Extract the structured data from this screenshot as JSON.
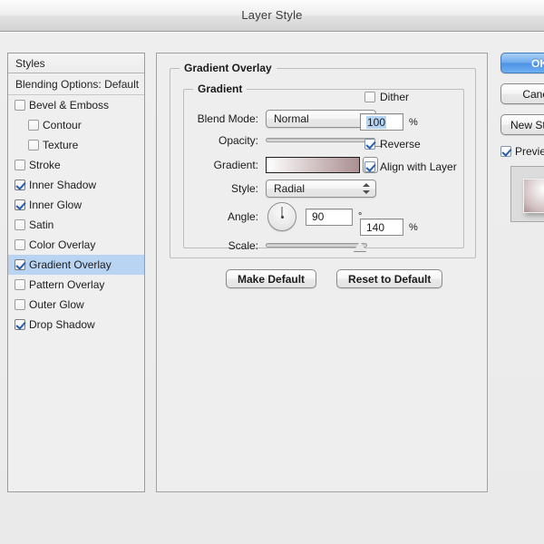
{
  "window": {
    "title": "Layer Style"
  },
  "styles_panel": {
    "header": "Styles",
    "blending_options": "Blending Options: Default",
    "items": [
      {
        "label": "Bevel & Emboss",
        "checked": false,
        "indent": false,
        "selected": false
      },
      {
        "label": "Contour",
        "checked": false,
        "indent": true,
        "selected": false
      },
      {
        "label": "Texture",
        "checked": false,
        "indent": true,
        "selected": false
      },
      {
        "label": "Stroke",
        "checked": false,
        "indent": false,
        "selected": false
      },
      {
        "label": "Inner Shadow",
        "checked": true,
        "indent": false,
        "selected": false
      },
      {
        "label": "Inner Glow",
        "checked": true,
        "indent": false,
        "selected": false
      },
      {
        "label": "Satin",
        "checked": false,
        "indent": false,
        "selected": false
      },
      {
        "label": "Color Overlay",
        "checked": false,
        "indent": false,
        "selected": false
      },
      {
        "label": "Gradient Overlay",
        "checked": true,
        "indent": false,
        "selected": true
      },
      {
        "label": "Pattern Overlay",
        "checked": false,
        "indent": false,
        "selected": false
      },
      {
        "label": "Outer Glow",
        "checked": false,
        "indent": false,
        "selected": false
      },
      {
        "label": "Drop Shadow",
        "checked": true,
        "indent": false,
        "selected": false
      }
    ],
    "selection_color": "#b9d4f2"
  },
  "main": {
    "section_title": "Gradient Overlay",
    "subsection_title": "Gradient",
    "blend_mode": {
      "label": "Blend Mode:",
      "value": "Normal"
    },
    "dither": {
      "label": "Dither",
      "checked": false
    },
    "opacity": {
      "label": "Opacity:",
      "value": "100",
      "unit": "%",
      "slider_percent": 100,
      "selected": true
    },
    "gradient": {
      "label": "Gradient:",
      "start_color": "#ffffff",
      "mid_color": "#cdbcbd",
      "end_color": "#ab9092"
    },
    "reverse": {
      "label": "Reverse",
      "checked": true
    },
    "style": {
      "label": "Style:",
      "value": "Radial"
    },
    "align_with_layer": {
      "label": "Align with Layer",
      "checked": true
    },
    "angle": {
      "label": "Angle:",
      "value": "90",
      "unit": "°",
      "degrees": 90
    },
    "scale": {
      "label": "Scale:",
      "value": "140",
      "unit": "%",
      "slider_percent": 93
    },
    "make_default_label": "Make Default",
    "reset_default_label": "Reset to Default"
  },
  "buttons": {
    "ok": "OK",
    "cancel": "Cancel",
    "new_style": "New Style...",
    "preview": {
      "label": "Preview",
      "checked": true
    },
    "ok_color": "#4d92e4"
  }
}
